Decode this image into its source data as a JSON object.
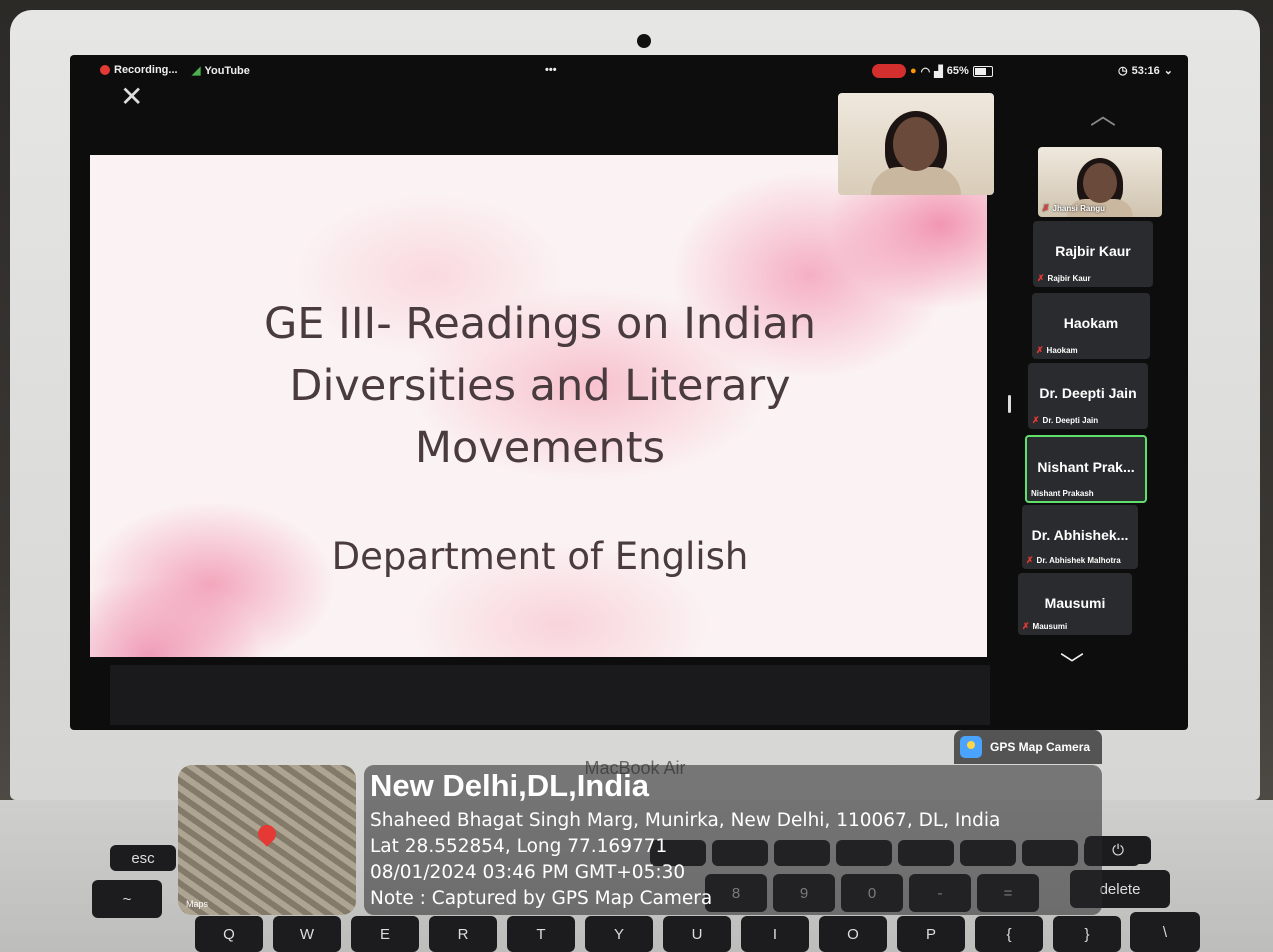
{
  "menubar": {
    "recording": "Recording...",
    "app": "YouTube",
    "dots": "•••",
    "battery": "65%",
    "time": "53:16"
  },
  "slide": {
    "title": "GE III- Readings on Indian\nDiversities and Literary\nMovements",
    "subtitle": "Department of English"
  },
  "participants": [
    {
      "big": "",
      "small": "Jhansi Rangu",
      "video": true
    },
    {
      "big": "Rajbir Kaur",
      "small": "Rajbir Kaur"
    },
    {
      "big": "Haokam",
      "small": "Haokam"
    },
    {
      "big": "Dr. Deepti Jain",
      "small": "Dr. Deepti Jain"
    },
    {
      "big": "Nishant Prak...",
      "small": "Nishant Prakash",
      "active": true
    },
    {
      "big": "Dr. Abhishek...",
      "small": "Dr. Abhishek Malhotra"
    },
    {
      "big": "Mausumi",
      "small": "Mausumi"
    }
  ],
  "device_label": "MacBook Air",
  "keys": {
    "esc": "esc",
    "delete": "delete",
    "row": [
      "Q",
      "W",
      "E",
      "R",
      "T",
      "Y",
      "U",
      "I",
      "O",
      "P",
      "{",
      "}"
    ],
    "num": [
      "8",
      "9",
      "0",
      "-",
      "="
    ]
  },
  "gps": {
    "app": "GPS Map Camera",
    "city": "New Delhi,DL,India",
    "address": "Shaheed Bhagat Singh Marg, Munirka, New Delhi, 110067, DL, India",
    "coords": "Lat 28.552854, Long 77.169771",
    "datetime": "08/01/2024 03:46 PM GMT+05:30",
    "note": "Note : Captured by GPS Map Camera",
    "maps_label": "Maps"
  }
}
